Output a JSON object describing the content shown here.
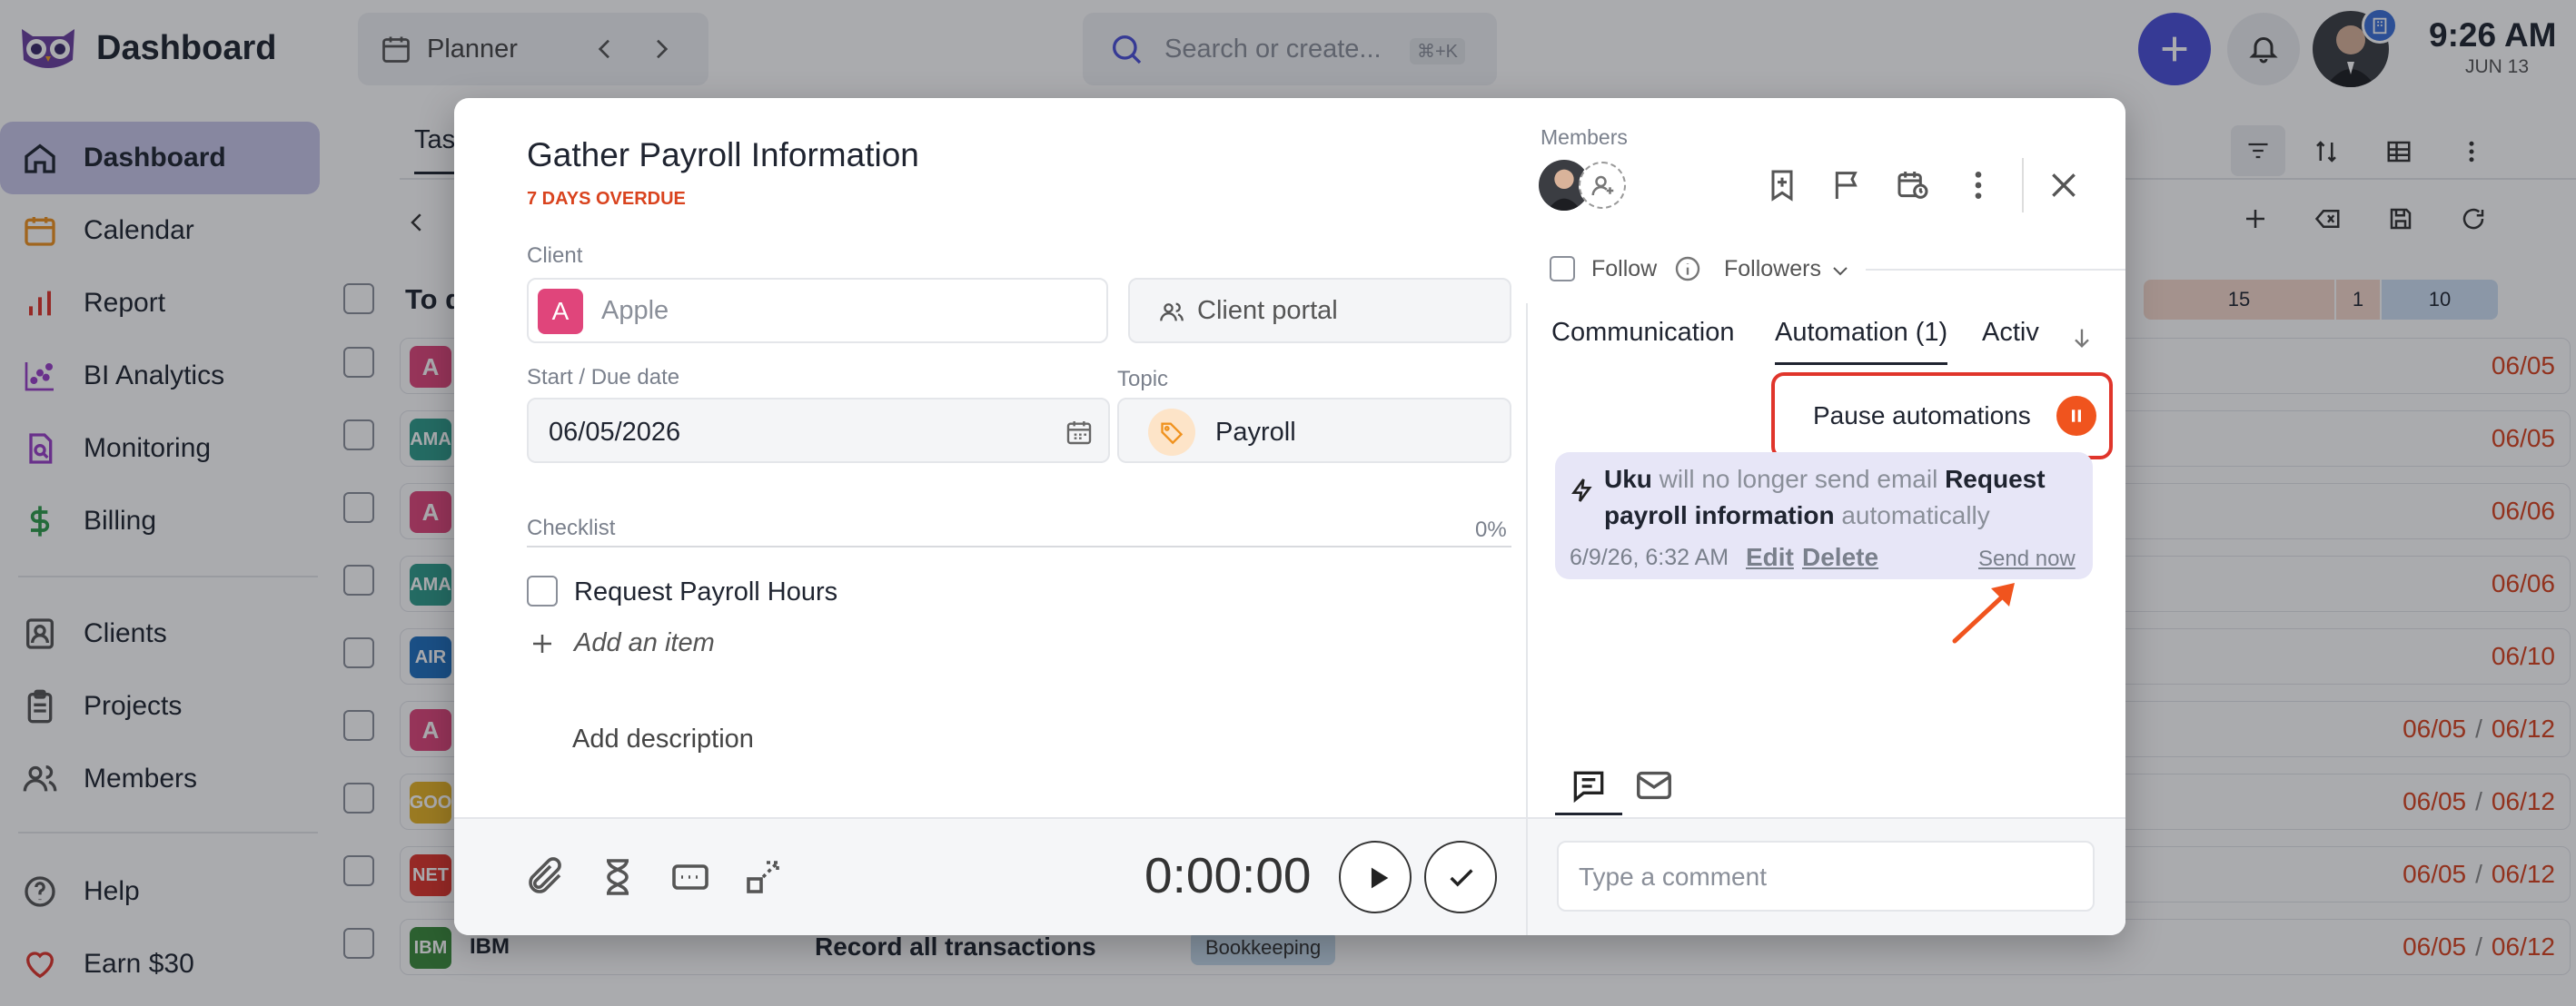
{
  "app": {
    "title": "Dashboard",
    "time": "9:26 AM",
    "date": "JUN 13"
  },
  "topbar": {
    "view_label": "Planner",
    "search_placeholder": "Search or create...",
    "search_shortcut": "⌘+K"
  },
  "sidebar": {
    "items": [
      {
        "label": "Dashboard",
        "icon": "home-icon"
      },
      {
        "label": "Calendar",
        "icon": "calendar-icon"
      },
      {
        "label": "Report",
        "icon": "bar-chart-icon"
      },
      {
        "label": "BI Analytics",
        "icon": "scatter-icon"
      },
      {
        "label": "Monitoring",
        "icon": "monitoring-icon"
      },
      {
        "label": "Billing",
        "icon": "dollar-icon"
      },
      {
        "label": "Clients",
        "icon": "clients-icon"
      },
      {
        "label": "Projects",
        "icon": "clipboard-icon"
      },
      {
        "label": "Members",
        "icon": "members-icon"
      },
      {
        "label": "Help",
        "icon": "help-icon"
      },
      {
        "label": "Earn $30",
        "icon": "heart-icon"
      }
    ]
  },
  "background": {
    "tab_partial": "Tas",
    "group_partial": "To d",
    "counters": [
      "15",
      "1",
      "10"
    ],
    "rows": [
      {
        "badge": "A",
        "color": "#e0457b",
        "date_start": "",
        "date_end": "06/05"
      },
      {
        "badge": "AMA",
        "color": "#2e9c8a",
        "date_start": "",
        "date_end": "06/05"
      },
      {
        "badge": "A",
        "color": "#e0457b",
        "date_start": "",
        "date_end": "06/06"
      },
      {
        "badge": "AMA",
        "color": "#2e9c8a",
        "date_start": "",
        "date_end": "06/06"
      },
      {
        "badge": "AIR",
        "color": "#1f6fbf",
        "date_start": "",
        "date_end": "06/10"
      },
      {
        "badge": "A",
        "color": "#e0457b",
        "date_start": "06/05",
        "date_end": "06/12"
      },
      {
        "badge": "GOO",
        "color": "#e6b324",
        "date_start": "06/05",
        "date_end": "06/12"
      },
      {
        "badge": "NET",
        "color": "#e0352b",
        "date_start": "06/05",
        "date_end": "06/12"
      },
      {
        "badge": "IBM",
        "color": "#3a8a3a",
        "date_start": "06/05",
        "date_end": "06/12",
        "client": "IBM",
        "task": "Record all transactions",
        "tag": "Bookkeeping"
      }
    ],
    "date_separator": "/"
  },
  "modal": {
    "title": "Gather Payroll Information",
    "overdue": "7 DAYS OVERDUE",
    "client_label": "Client",
    "client_badge": "A",
    "client_value": "Apple",
    "client_portal": "Client portal",
    "dates_label": "Start / Due date",
    "date_value": "06/05/2026",
    "topic_label": "Topic",
    "topic_value": "Payroll",
    "checklist_label": "Checklist",
    "checklist_percent": "0%",
    "checklist_items": [
      "Request Payroll Hours"
    ],
    "add_item": "Add an item",
    "add_description": "Add description",
    "timer": "0:00:00",
    "members_label": "Members",
    "follow_label": "Follow",
    "followers_label": "Followers",
    "tabs": [
      "Communication",
      "Automation (1)",
      "Activ"
    ],
    "pause_label": "Pause automations",
    "automation": {
      "user": "Uku",
      "text1": " will no longer send email ",
      "bold": "Request payroll information",
      "text2": " automatically",
      "timestamp": "6/9/26, 6:32 AM",
      "edit": "Edit",
      "delete": "Delete",
      "send_now": "Send now"
    },
    "comment_placeholder": "Type a comment"
  },
  "colors": {
    "accent": "#4a4fd8",
    "overdue": "#d9431e",
    "highlight": "#e0352b",
    "pause": "#f0541e"
  }
}
